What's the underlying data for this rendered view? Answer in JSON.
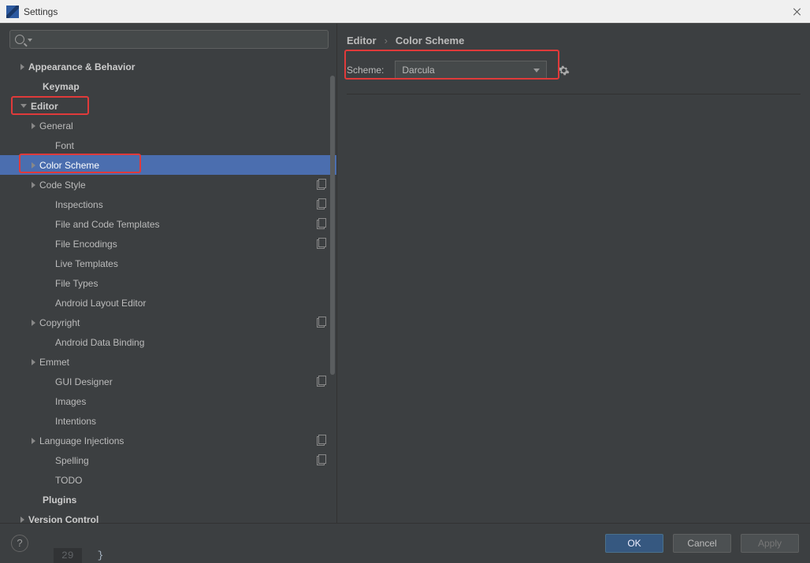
{
  "window": {
    "title": "Settings"
  },
  "search": {
    "placeholder": ""
  },
  "breadcrumb": {
    "part1": "Editor",
    "sep": "›",
    "part2": "Color Scheme"
  },
  "scheme": {
    "label": "Scheme:",
    "value": "Darcula"
  },
  "tree": [
    {
      "pad": 26,
      "arrow": "right",
      "label": "Appearance & Behavior",
      "bold": true
    },
    {
      "pad": 40,
      "arrow": "none",
      "label": "Keymap",
      "bold": true
    },
    {
      "pad": 26,
      "arrow": "down",
      "label": "Editor",
      "bold": true
    },
    {
      "pad": 40,
      "arrow": "right",
      "label": "General"
    },
    {
      "pad": 56,
      "arrow": "none",
      "label": "Font"
    },
    {
      "pad": 40,
      "arrow": "right",
      "label": "Color Scheme",
      "selected": true
    },
    {
      "pad": 40,
      "arrow": "right",
      "label": "Code Style",
      "overlay": true
    },
    {
      "pad": 56,
      "arrow": "none",
      "label": "Inspections",
      "overlay": true
    },
    {
      "pad": 56,
      "arrow": "none",
      "label": "File and Code Templates",
      "overlay": true
    },
    {
      "pad": 56,
      "arrow": "none",
      "label": "File Encodings",
      "overlay": true
    },
    {
      "pad": 56,
      "arrow": "none",
      "label": "Live Templates"
    },
    {
      "pad": 56,
      "arrow": "none",
      "label": "File Types"
    },
    {
      "pad": 56,
      "arrow": "none",
      "label": "Android Layout Editor"
    },
    {
      "pad": 40,
      "arrow": "right",
      "label": "Copyright",
      "overlay": true
    },
    {
      "pad": 56,
      "arrow": "none",
      "label": "Android Data Binding"
    },
    {
      "pad": 40,
      "arrow": "right",
      "label": "Emmet"
    },
    {
      "pad": 56,
      "arrow": "none",
      "label": "GUI Designer",
      "overlay": true
    },
    {
      "pad": 56,
      "arrow": "none",
      "label": "Images"
    },
    {
      "pad": 56,
      "arrow": "none",
      "label": "Intentions"
    },
    {
      "pad": 40,
      "arrow": "right",
      "label": "Language Injections",
      "overlay": true
    },
    {
      "pad": 56,
      "arrow": "none",
      "label": "Spelling",
      "overlay": true
    },
    {
      "pad": 56,
      "arrow": "none",
      "label": "TODO"
    },
    {
      "pad": 40,
      "arrow": "none",
      "label": "Plugins",
      "bold": true
    },
    {
      "pad": 26,
      "arrow": "right",
      "label": "Version Control",
      "bold": true
    }
  ],
  "footer": {
    "help": "?",
    "ok": "OK",
    "cancel": "Cancel",
    "apply": "Apply"
  },
  "peek": {
    "line": "29",
    "brace": "}"
  }
}
